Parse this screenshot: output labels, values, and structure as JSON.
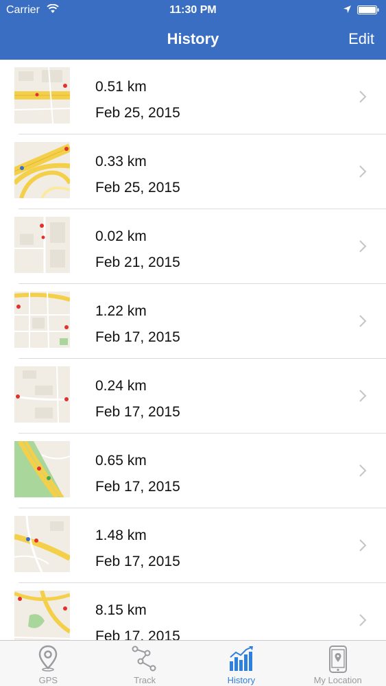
{
  "status_bar": {
    "carrier": "Carrier",
    "time": "11:30 PM"
  },
  "nav": {
    "title": "History",
    "edit_label": "Edit"
  },
  "history": [
    {
      "distance": "0.51 km",
      "date": "Feb 25, 2015"
    },
    {
      "distance": "0.33 km",
      "date": "Feb 25, 2015"
    },
    {
      "distance": "0.02 km",
      "date": "Feb 21, 2015"
    },
    {
      "distance": "1.22 km",
      "date": "Feb 17, 2015"
    },
    {
      "distance": "0.24 km",
      "date": "Feb 17, 2015"
    },
    {
      "distance": "0.65 km",
      "date": "Feb 17, 2015"
    },
    {
      "distance": "1.48 km",
      "date": "Feb 17, 2015"
    },
    {
      "distance": "8.15 km",
      "date": "Feb 17, 2015"
    }
  ],
  "tabs": [
    {
      "label": "GPS",
      "icon": "map-pin-icon",
      "active": false
    },
    {
      "label": "Track",
      "icon": "track-nodes-icon",
      "active": false
    },
    {
      "label": "History",
      "icon": "bar-chart-icon",
      "active": true
    },
    {
      "label": "My Location",
      "icon": "phone-location-icon",
      "active": false
    }
  ],
  "colors": {
    "nav_bar": "#3a6ec3",
    "active_tab": "#2f7fde",
    "inactive_tab": "#9a9a9f",
    "map_road": "#f4cf4a",
    "map_land": "#f1ede4",
    "map_park": "#a9d69a"
  }
}
